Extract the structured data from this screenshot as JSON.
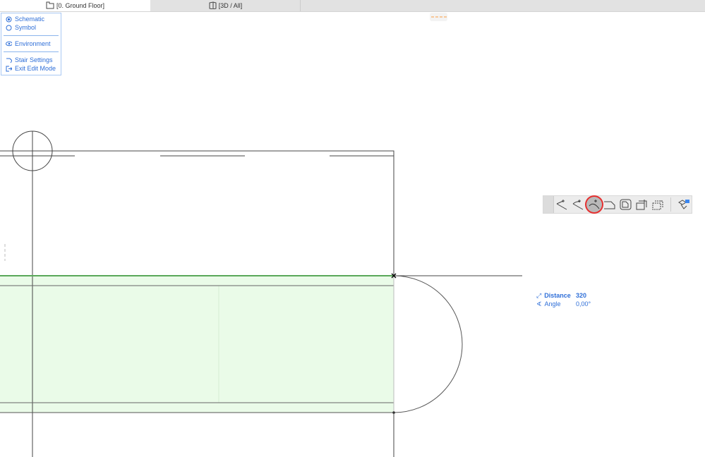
{
  "tabs": [
    {
      "label": "[0. Ground Floor]",
      "icon": "floor-plan-icon",
      "active": true
    },
    {
      "label": "[3D / All]",
      "icon": "3d-box-icon",
      "active": false
    }
  ],
  "menu": {
    "schematic": "Schematic",
    "symbol": "Symbol",
    "environment": "Environment",
    "stair_settings": "Stair Settings",
    "exit_edit_mode": "Exit Edit Mode",
    "selected_view": "Schematic"
  },
  "toolbar": {
    "tools": [
      "offset-edge-icon",
      "curve-edge-icon",
      "arc-fillet-icon",
      "chamfer-icon",
      "fillet-polygon-icon",
      "add-polygon-icon",
      "subtract-polygon-icon",
      "settings-icon"
    ],
    "selected": "arc-fillet-icon"
  },
  "tracker": {
    "distance_label": "Distance",
    "distance_value": "320",
    "angle_label": "Angle",
    "angle_value": "0,00°"
  },
  "colors": {
    "accent": "#2f6fd8",
    "selection_fill": "#eafbe8",
    "highlight": "#e53030"
  }
}
